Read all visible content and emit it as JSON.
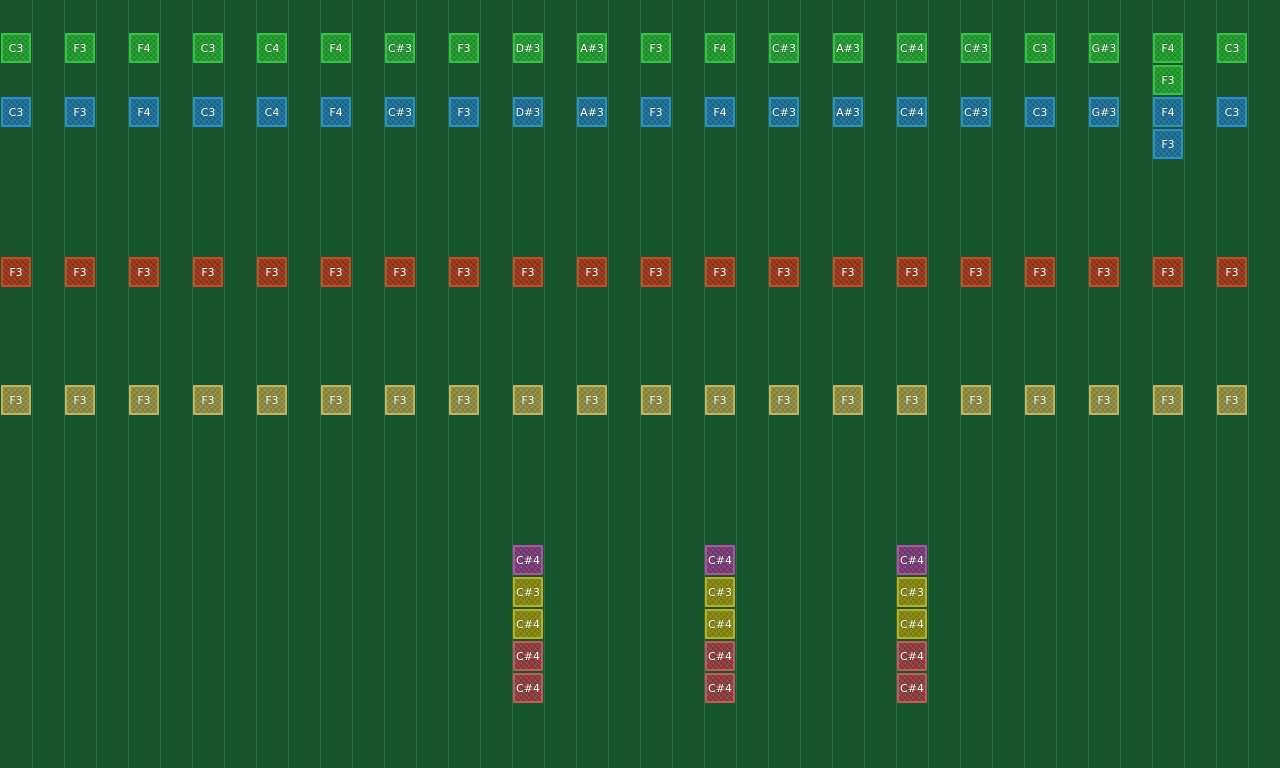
{
  "palette": {
    "background": "#185330",
    "gridline": "#2d6a47",
    "green": {
      "fill": "#1f9a2c",
      "border": "#37c247"
    },
    "blue": {
      "fill": "#1c6e96",
      "border": "#2c93bf"
    },
    "red": {
      "fill": "#9a3718",
      "border": "#c44f26"
    },
    "khaki": {
      "fill": "#8f8a40",
      "border": "#bdb55d"
    },
    "purple": {
      "fill": "#7a3a74",
      "border": "#a9569f"
    },
    "olive": {
      "fill": "#86860f",
      "border": "#b6b41d"
    },
    "rose": {
      "fill": "#8e3c3e",
      "border": "#bd5b5d"
    }
  },
  "tracks": [
    {
      "name": "green-track",
      "color": "green",
      "notes": [
        "C3",
        "F3",
        "F4",
        "C3",
        "C4",
        "F4",
        "C#3",
        "F3",
        "D#3",
        "A#3",
        "F3",
        "F4",
        "C#3",
        "A#3",
        "C#4",
        "C#3",
        "C3",
        "G#3",
        "F4",
        "C3"
      ],
      "extra": [
        {
          "col": 18,
          "label": "F3"
        }
      ]
    },
    {
      "name": "blue-track",
      "color": "blue",
      "notes": [
        "C3",
        "F3",
        "F4",
        "C3",
        "C4",
        "F4",
        "C#3",
        "F3",
        "D#3",
        "A#3",
        "F3",
        "F4",
        "C#3",
        "A#3",
        "C#4",
        "C#3",
        "C3",
        "G#3",
        "F4",
        "C3"
      ],
      "extra": [
        {
          "col": 18,
          "label": "F3"
        }
      ]
    },
    {
      "name": "red-track",
      "color": "red",
      "notes": [
        "F3",
        "F3",
        "F3",
        "F3",
        "F3",
        "F3",
        "F3",
        "F3",
        "F3",
        "F3",
        "F3",
        "F3",
        "F3",
        "F3",
        "F3",
        "F3",
        "F3",
        "F3",
        "F3",
        "F3"
      ],
      "extra": []
    },
    {
      "name": "khaki-track",
      "color": "khaki",
      "notes": [
        "F3",
        "F3",
        "F3",
        "F3",
        "F3",
        "F3",
        "F3",
        "F3",
        "F3",
        "F3",
        "F3",
        "F3",
        "F3",
        "F3",
        "F3",
        "F3",
        "F3",
        "F3",
        "F3",
        "F3"
      ],
      "extra": []
    }
  ],
  "stacks": [
    {
      "col": 8,
      "notes": [
        {
          "label": "C#4",
          "color": "purple"
        },
        {
          "label": "C#3",
          "color": "olive"
        },
        {
          "label": "C#4",
          "color": "olive"
        },
        {
          "label": "C#4",
          "color": "rose"
        },
        {
          "label": "C#4",
          "color": "rose"
        }
      ]
    },
    {
      "col": 11,
      "notes": [
        {
          "label": "C#4",
          "color": "purple"
        },
        {
          "label": "C#3",
          "color": "olive"
        },
        {
          "label": "C#4",
          "color": "olive"
        },
        {
          "label": "C#4",
          "color": "rose"
        },
        {
          "label": "C#4",
          "color": "rose"
        }
      ]
    },
    {
      "col": 14,
      "notes": [
        {
          "label": "C#4",
          "color": "purple"
        },
        {
          "label": "C#3",
          "color": "olive"
        },
        {
          "label": "C#4",
          "color": "olive"
        },
        {
          "label": "C#4",
          "color": "rose"
        },
        {
          "label": "C#4",
          "color": "rose"
        }
      ]
    }
  ]
}
